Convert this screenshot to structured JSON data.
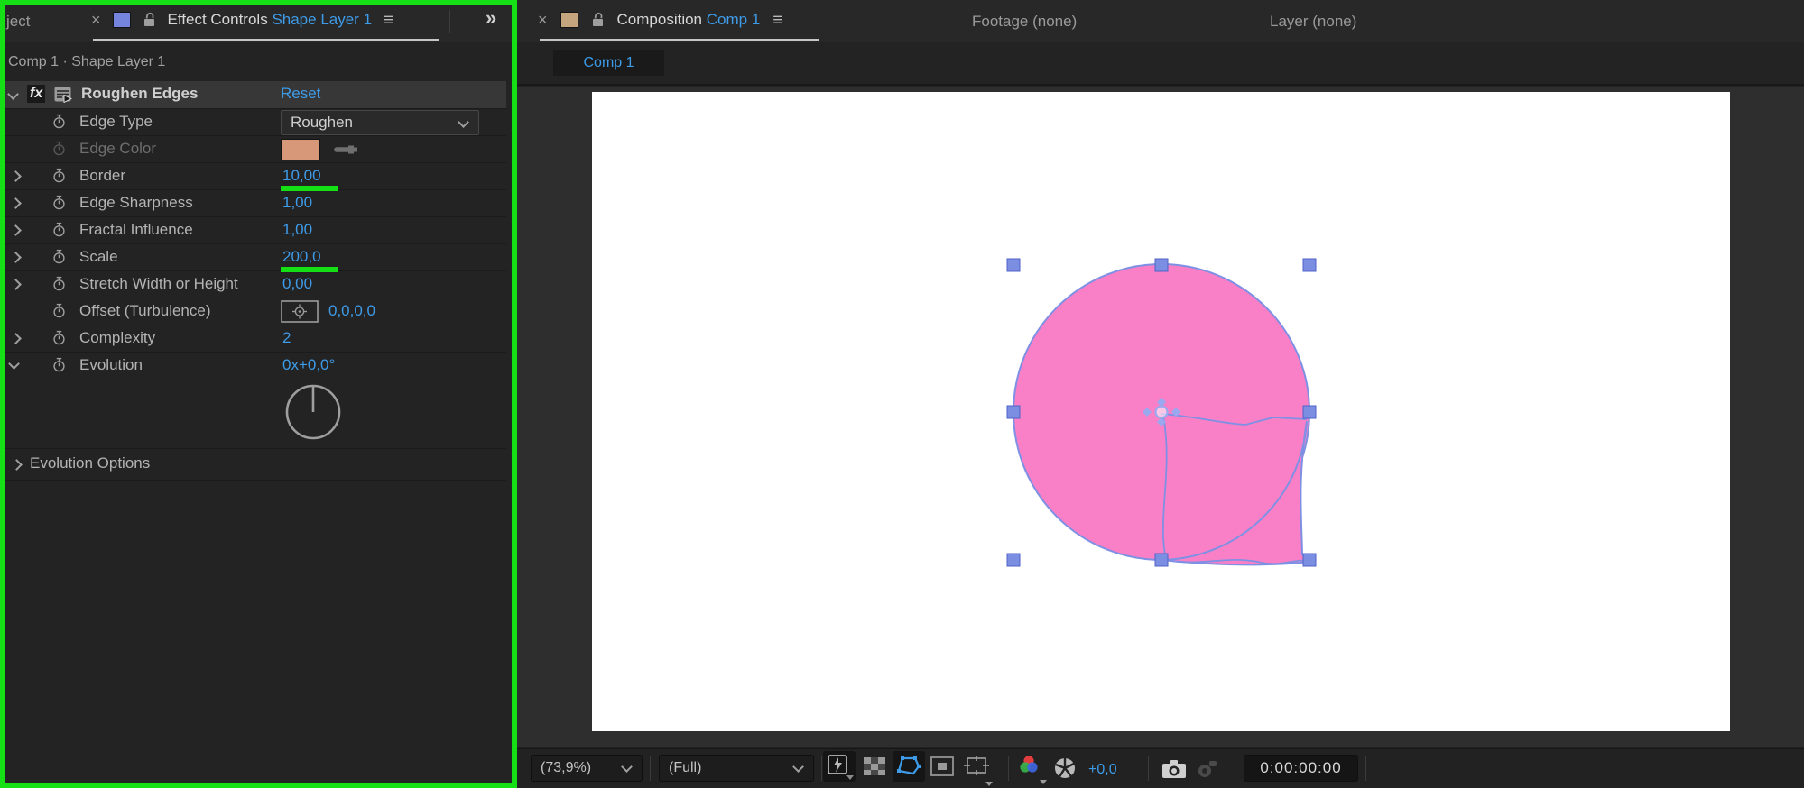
{
  "colors": {
    "accent_blue": "#3e9be8",
    "annotation_green": "#15e015",
    "shape_pink": "#f980c7",
    "selection_handle_blue": "#7b8ee1",
    "shape_path_stroke": "#7e90e4",
    "edge_color_swatch": "#d69878",
    "comp_tab_swatch_tan": "#c4a57e",
    "layer_tab_swatch_blue": "#7585dd"
  },
  "left_panel": {
    "partial_tab": "ject",
    "tab": {
      "close": "×",
      "title": "Effect Controls",
      "target": "Shape Layer 1",
      "menu": "≡",
      "collapse": "»"
    },
    "breadcrumb": "Comp 1 · Shape Layer 1",
    "effect": {
      "fx_badge": "fx",
      "name": "Roughen Edges",
      "reset_label": "Reset"
    },
    "params": [
      {
        "label": "Edge Type",
        "type": "dropdown",
        "value": "Roughen"
      },
      {
        "label": "Edge Color",
        "type": "color",
        "swatch": "#d69878",
        "disabled": true
      },
      {
        "label": "Border",
        "type": "value",
        "value": "10,00",
        "expandable": true,
        "highlight": true
      },
      {
        "label": "Edge Sharpness",
        "type": "value",
        "value": "1,00",
        "expandable": true
      },
      {
        "label": "Fractal Influence",
        "type": "value",
        "value": "1,00",
        "expandable": true
      },
      {
        "label": "Scale",
        "type": "value",
        "value": "200,0",
        "expandable": true,
        "highlight": true
      },
      {
        "label": "Stretch Width or Height",
        "type": "value",
        "value": "0,00",
        "expandable": true
      },
      {
        "label": "Offset (Turbulence)",
        "type": "point",
        "value": "0,0,0,0"
      },
      {
        "label": "Complexity",
        "type": "value",
        "value": "2",
        "expandable": true
      },
      {
        "label": "Evolution",
        "type": "angle",
        "value": "0x+0,0°",
        "expanded": true
      }
    ],
    "evolution_dial_angle_deg": 0,
    "evolution_options_label": "Evolution Options"
  },
  "right_panel": {
    "tab": {
      "close": "×",
      "title": "Composition",
      "target": "Comp 1",
      "menu": "≡"
    },
    "inactive_tabs": [
      "Footage (none)",
      "Layer (none)"
    ],
    "viewer_tab": "Comp 1",
    "toolbar": {
      "magnification": "(73,9%)",
      "resolution": "(Full)",
      "exposure": "+0,0",
      "timecode": "0:00:00:00"
    }
  }
}
